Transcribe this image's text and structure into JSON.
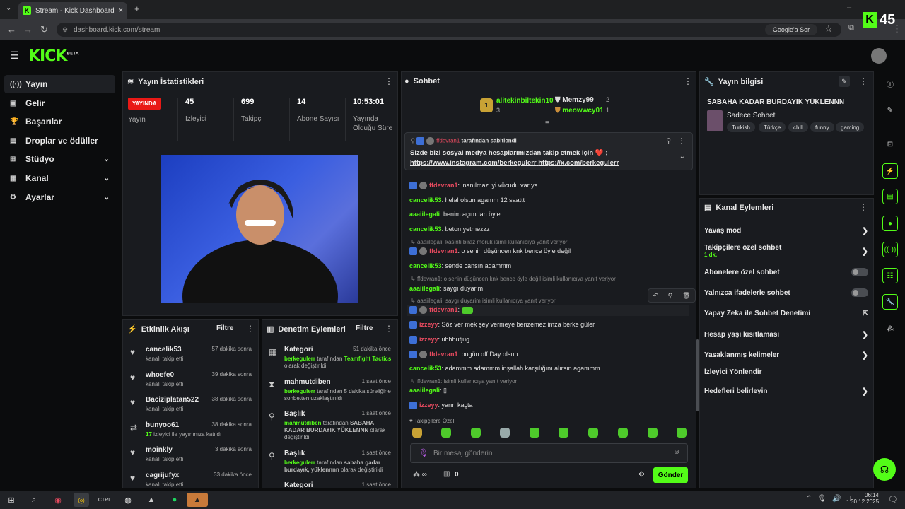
{
  "browser": {
    "tab_title": "Stream - Kick Dashboard",
    "url": "dashboard.kick.com/stream",
    "google_label": "Google'a Sor",
    "overlay_count": "45"
  },
  "header": {
    "logo": "KICK",
    "beta": "BETA"
  },
  "sidebar": {
    "items": [
      {
        "label": "Yayın"
      },
      {
        "label": "Gelir"
      },
      {
        "label": "Başarılar"
      },
      {
        "label": "Droplar ve ödüller"
      },
      {
        "label": "Stüdyo"
      },
      {
        "label": "Kanal"
      },
      {
        "label": "Ayarlar"
      }
    ]
  },
  "stats": {
    "title": "Yayın İstatistikleri",
    "live_badge": "YAYINDA",
    "live_label": "Yayın",
    "items": [
      {
        "value": "45",
        "label": "İzleyici"
      },
      {
        "value": "699",
        "label": "Takipçi"
      },
      {
        "value": "14",
        "label": "Abone Sayısı"
      },
      {
        "value": "10:53:01",
        "label": "Yayında Olduğu Süre"
      }
    ]
  },
  "activity": {
    "title": "Etkinlik Akışı",
    "filter": "Filtre",
    "items": [
      {
        "name": "cancelik53",
        "desc": "kanalı takip etti",
        "time": "57 dakika sonra"
      },
      {
        "name": "whoefe0",
        "desc": "kanalı takip etti",
        "time": "39 dakika sonra"
      },
      {
        "name": "Baciziplatan522",
        "desc": "kanalı takip etti",
        "time": "38 dakika sonra"
      },
      {
        "name": "bunyoo61",
        "desc_count": "17",
        "desc": "izleyici ile yayınınıza katıldı",
        "time": "38 dakika sonra"
      },
      {
        "name": "moinkly",
        "desc": "kanalı takip etti",
        "time": "3 dakika sonra"
      },
      {
        "name": "cagrijufyx",
        "desc": "kanalı takip etti",
        "time": "33 dakika önce"
      }
    ]
  },
  "moderation": {
    "title": "Denetim Eylemleri",
    "filter": "Filtre",
    "items": [
      {
        "name": "Kategori",
        "time": "51 dakika önce",
        "actor": "berkegulerr",
        "pre": "tarafından",
        "value": "Teamfight Tactics",
        "post": "olarak değiştirildi"
      },
      {
        "name": "mahmutdiben",
        "time": "1 saat önce",
        "actor": "berkegulerr",
        "pre": "tarafından 5 dakika süreliğine sohbetten uzaklaştırıldı",
        "value": "",
        "post": ""
      },
      {
        "name": "Başlık",
        "time": "1 saat önce",
        "actor": "mahmutdiben",
        "pre": "tarafından",
        "value": "SABAHA KADAR BURDAYIK YÜKLENNN",
        "post": "olarak değiştirildi"
      },
      {
        "name": "Başlık",
        "time": "1 saat önce",
        "actor": "berkegulerr",
        "pre": "tarafından",
        "value": "sabaha gadar burdayık, yüklennnn",
        "post": "olarak değiştirildi"
      },
      {
        "name": "Kategori",
        "time": "1 saat önce"
      }
    ]
  },
  "chat": {
    "title": "Sohbet",
    "leaders": [
      {
        "name": "alitekinbiltekin10",
        "count": "3"
      },
      {
        "name": "Memzy99",
        "count": "2"
      },
      {
        "name": "meowwcy01",
        "count": "1"
      }
    ],
    "pinned": {
      "by": "ffdevran1",
      "by_suffix": "tarafından sabitlendi",
      "text": "Sizde bizi sosyal medya hesaplarımızdan takip etmek için ❤️ ;",
      "link1": "https://www.instagram.com/berkegulerr",
      "link2": "https://x.com/berkegulerr"
    },
    "messages": [
      {
        "user": "aaaiilegali",
        "text": "kasinti biraz moruk",
        "color": "#53fc18",
        "reply": ""
      },
      {
        "user": "ffdevran1",
        "text": "inanılmaz iyi vücudu var ya",
        "color": "#e84a5f",
        "badges": true
      },
      {
        "user": "cancelik53",
        "text": "helal olsun agamm 12 saattt",
        "color": "#53fc18"
      },
      {
        "user": "aaaiilegali",
        "text": "benim açımdan öyle",
        "color": "#53fc18"
      },
      {
        "user": "cancelik53",
        "text": "beton yetmezzz",
        "color": "#53fc18"
      },
      {
        "reply": "aaaiilegali: kasinti biraz moruk isimli kullanıcıya yanıt veriyor"
      },
      {
        "user": "ffdevran1",
        "text": "o senin düşüncen knk bence öyle değil",
        "color": "#e84a5f",
        "badges": true
      },
      {
        "user": "cancelik53",
        "text": "sende cansın agammm",
        "color": "#53fc18"
      },
      {
        "reply": "ffdevran1: o senin düşüncen knk bence öyle değil isimli kullanıcıya yanıt veriyor"
      },
      {
        "user": "aaaiilegali",
        "text": "saygı duyarim",
        "color": "#53fc18"
      },
      {
        "reply": "aaaiilegali: saygı duyarim isimli kullanıcıya yanıt veriyor"
      },
      {
        "user": "ffdevran1",
        "text": "",
        "color": "#e84a5f",
        "badges": true,
        "emote": true
      },
      {
        "user": "izzeyy",
        "text": "Söz ver mek şey vermeye benzemez imza berke güler",
        "color": "#e84a5f",
        "badge1": true
      },
      {
        "user": "izzeyy",
        "text": "uhhhufjug",
        "color": "#e84a5f",
        "badge1": true
      },
      {
        "user": "ffdevran1",
        "text": "bugün off Day olsun",
        "color": "#e84a5f",
        "badges": true
      },
      {
        "user": "cancelik53",
        "text": "adammm adammm inşallah karşılığını alırsın agammm",
        "color": "#53fc18"
      },
      {
        "reply": "ffdevran1: isimli kullanıcıya yanıt veriyor"
      },
      {
        "user": "aaaiilegali",
        "text": "▯",
        "color": "#53fc18"
      },
      {
        "user": "izzeyy",
        "text": "yarın kaçta",
        "color": "#e84a5f",
        "badge1": true
      }
    ],
    "followers_only": "Takipçilere Özel",
    "input_placeholder": "Bir mesaj gönderin",
    "points": "0",
    "send": "Gönder"
  },
  "stream_info": {
    "title": "Yayın bilgisi",
    "stream_title": "SABAHA KADAR BURDAYIK YÜKLENNN",
    "category": "Sadece Sohbet",
    "tags": [
      "Turkish",
      "Türkçe",
      "chill",
      "funny",
      "gaming"
    ]
  },
  "channel_actions": {
    "title": "Kanal Eylemleri",
    "items": [
      {
        "label": "Yavaş mod",
        "type": "chev"
      },
      {
        "label": "Takipçilere özel sohbet",
        "sub": "1 dk.",
        "type": "chev"
      },
      {
        "label": "Abonelere özel sohbet",
        "type": "toggle"
      },
      {
        "label": "Yalnızca ifadelerle sohbet",
        "type": "toggle"
      },
      {
        "label": "Yapay Zeka ile Sohbet Denetimi",
        "type": "ext"
      },
      {
        "label": "Hesap yaşı kısıtlaması",
        "type": "chev"
      },
      {
        "label": "Yasaklanmış kelimeler",
        "type": "chev"
      },
      {
        "label": "İzleyici Yönlendir",
        "type": "none"
      },
      {
        "label": "Hedefleri belirleyin",
        "type": "chev"
      }
    ]
  },
  "taskbar": {
    "time": "06:14",
    "date": "30.12.2025"
  },
  "colors": {
    "accent": "#53fc18",
    "live": "#e91916",
    "panel": "#191b1f"
  }
}
